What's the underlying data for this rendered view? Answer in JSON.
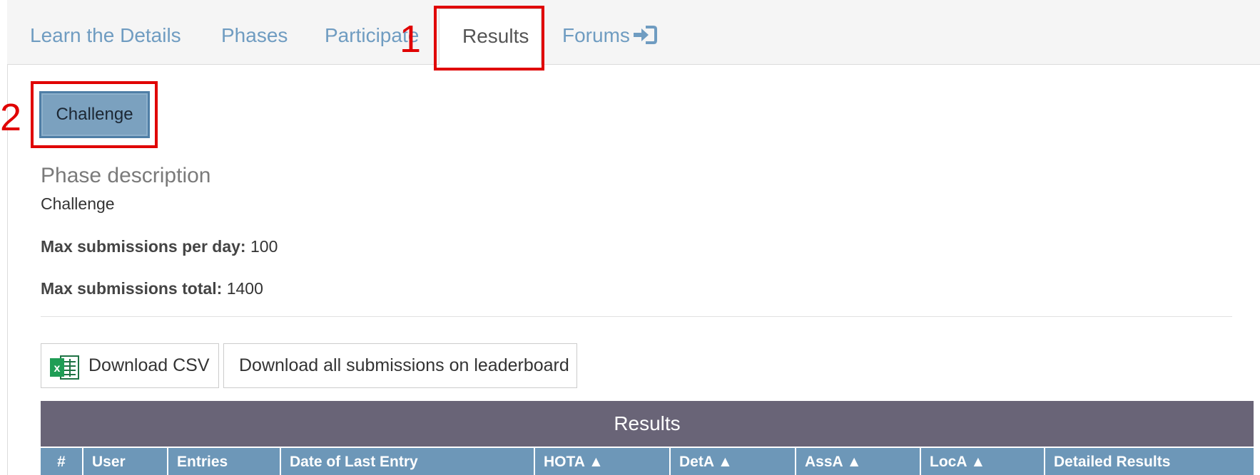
{
  "tabs": {
    "learn": "Learn the Details",
    "phases": "Phases",
    "participate": "Participate",
    "results": "Results",
    "forums": "Forums"
  },
  "annotations": {
    "one": "1",
    "two": "2"
  },
  "phase": {
    "button_label": "Challenge",
    "desc_title": "Phase description",
    "desc_text": "Challenge",
    "max_day_label": "Max submissions per day:",
    "max_day_value": "100",
    "max_total_label": "Max submissions total:",
    "max_total_value": "1400"
  },
  "downloads": {
    "csv_label": "Download CSV",
    "all_label": "Download all submissions on leaderboard"
  },
  "results_table": {
    "title": "Results",
    "columns": [
      "#",
      "User",
      "Entries",
      "Date of Last Entry",
      "HOTA ▲",
      "DetA ▲",
      "AssA ▲",
      "LocA ▲",
      "Detailed Results"
    ]
  },
  "colors": {
    "tab_link": "#6f9cc1",
    "highlight": "#e00000",
    "results_header": "#696477",
    "column_header": "#6d97b8",
    "excel_green": "#1f7244"
  },
  "icons": {
    "forums": "sign-in-icon",
    "csv": "excel-icon"
  }
}
